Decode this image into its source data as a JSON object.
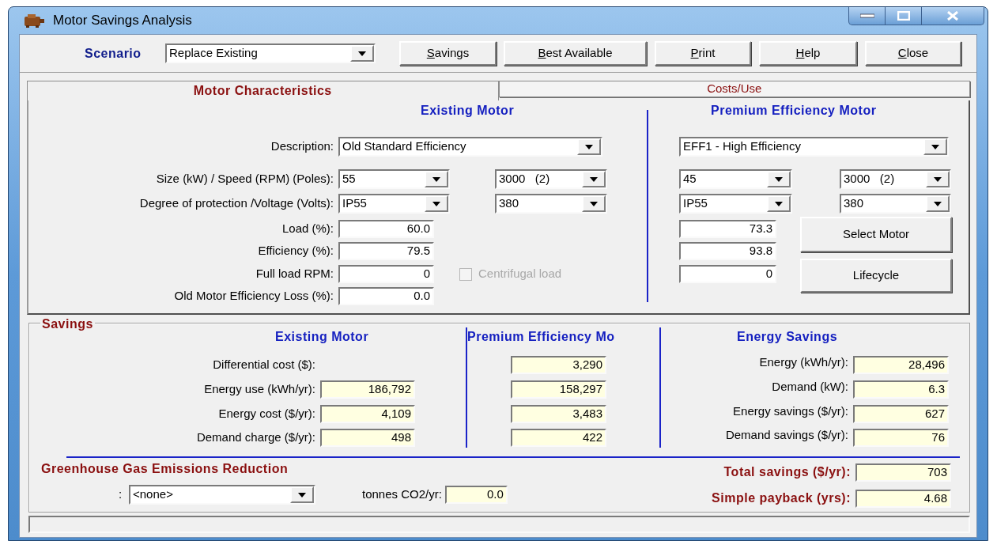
{
  "window": {
    "title": "Motor Savings Analysis"
  },
  "toolbar": {
    "scenario_label": "Scenario",
    "scenario": "Replace Existing",
    "buttons": [
      {
        "label": "Savings",
        "first_letter_underlined": true
      },
      {
        "label": "Best Available",
        "first_letter_underlined": true
      },
      {
        "label": "Print",
        "first_letter_underlined": true
      },
      {
        "label": "Help",
        "first_letter_underlined": true
      },
      {
        "label": "Close",
        "first_letter_underlined": true
      }
    ]
  },
  "tabs": [
    {
      "label": "Motor Characteristics",
      "selected": true
    },
    {
      "label": "Costs/Use",
      "selected": false
    }
  ],
  "motor": {
    "labels": {
      "description": "Description:",
      "size_speed": "Size (kW) / Speed (RPM) (Poles):",
      "protection_voltage": "Degree of protection /Voltage (Volts):",
      "load": "Load (%):",
      "efficiency": "Efficiency (%):",
      "full_load_rpm": "Full load RPM:",
      "efficiency_loss": "Old Motor Efficiency Loss (%):"
    },
    "existing": {
      "heading": "Existing Motor",
      "description": "Old Standard Efficiency",
      "size": "55",
      "speed": "3000   (2)",
      "protection": "IP55",
      "voltage": "380",
      "load": "60.0",
      "efficiency": "79.5",
      "full_load_rpm": "0",
      "efficiency_loss": "0.0"
    },
    "centrifugal_load": {
      "label": "Centrifugal load",
      "checked": false,
      "disabled": true
    },
    "premium": {
      "heading": "Premium Efficiency Motor",
      "description": "EFF1 - High Efficiency",
      "size": "45",
      "speed": "3000   (2)",
      "protection": "IP55",
      "voltage": "380",
      "load": "73.3",
      "efficiency": "93.8",
      "full_load_rpm": "0",
      "buttons": [
        "Select Motor",
        "Lifecycle"
      ]
    }
  },
  "savings": {
    "title": "Savings",
    "headings": [
      "Existing Motor",
      "Premium Efficiency Mo",
      "Energy Savings"
    ],
    "rows": [
      {
        "label": "Differential cost ($):",
        "premium": "3,290"
      },
      {
        "label": "Energy use (kWh/yr):",
        "existing": "186,792",
        "premium": "158,297"
      },
      {
        "label": "Energy cost ($/yr):",
        "existing": "4,109",
        "premium": "3,483"
      },
      {
        "label": "Demand charge ($/yr):",
        "existing": "498",
        "premium": "422"
      }
    ],
    "energy_savings": [
      {
        "label": "Energy (kWh/yr):",
        "value": "28,496"
      },
      {
        "label": "Demand (kW):",
        "value": "6.3"
      },
      {
        "label": "Energy savings ($/yr):",
        "value": "627"
      },
      {
        "label": "Demand savings ($/yr):",
        "value": "76"
      }
    ],
    "ghg": {
      "title": "Greenhouse Gas Emissions Reduction",
      "prefix": ":",
      "source": "<none>",
      "tonnes_label": "tonnes CO2/yr:",
      "tonnes": "0.0"
    },
    "totals": [
      {
        "label": "Total savings ($/yr):",
        "value": "703"
      },
      {
        "label": "Simple payback (yrs):",
        "value": "4.68"
      }
    ]
  }
}
